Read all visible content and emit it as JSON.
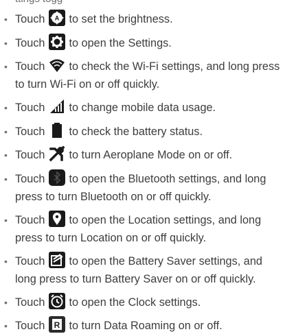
{
  "header_clipped_text": "ttings togg",
  "items": [
    {
      "prefix": "Touch",
      "text": "to set the brightness.",
      "icon": "brightness-auto-icon"
    },
    {
      "prefix": "Touch",
      "text": "to open the Settings.",
      "icon": "gear-icon"
    },
    {
      "prefix": "Touch",
      "text": "to check the Wi-Fi settings, and long press",
      "text2": "to turn Wi-Fi on or off quickly.",
      "icon": "wifi-icon"
    },
    {
      "prefix": "Touch",
      "text": "to change mobile data usage.",
      "icon": "signal-icon"
    },
    {
      "prefix": "Touch",
      "text": "to check the battery status.",
      "icon": "battery-icon"
    },
    {
      "prefix": "Touch",
      "text": "to turn Aeroplane Mode on or off.",
      "icon": "airplane-icon"
    },
    {
      "prefix": "Touch",
      "text": "to open the Bluetooth settings, and long",
      "text2": "press to turn Bluetooth on or off quickly.",
      "icon": "bluetooth-icon"
    },
    {
      "prefix": "Touch",
      "text": "to open the Location settings, and long",
      "text2": "press to turn Location on or off quickly.",
      "icon": "location-icon"
    },
    {
      "prefix": "Touch",
      "text": "to open the Battery Saver settings, and",
      "text2": "long press to turn Battery Saver on or off quickly.",
      "icon": "battery-saver-icon"
    },
    {
      "prefix": "Touch",
      "text": "to open the Clock settings.",
      "icon": "clock-icon"
    },
    {
      "prefix": "Touch",
      "text": "to turn Data Roaming on or off.",
      "icon": "data-roaming-icon"
    }
  ]
}
